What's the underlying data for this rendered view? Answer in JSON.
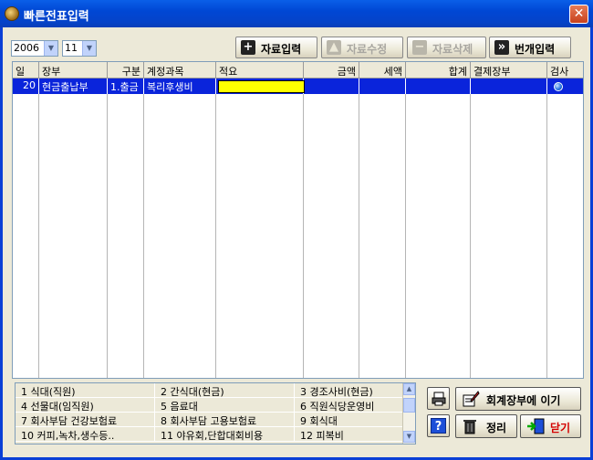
{
  "window": {
    "title": "빠른전표입력",
    "close": "✕"
  },
  "filters": {
    "year": "2006",
    "month": "11"
  },
  "toolbar": {
    "add": {
      "label": "자료입력",
      "icon": "plus-icon"
    },
    "edit": {
      "label": "자료수정",
      "icon": "triangle-up-icon"
    },
    "delete": {
      "label": "자료삭제",
      "icon": "minus-icon"
    },
    "bulk": {
      "label": "번개입력",
      "icon": "double-chevron-down-icon"
    }
  },
  "grid": {
    "columns": [
      "일",
      "장부",
      "구분",
      "계정과목",
      "적요",
      "금액",
      "세액",
      "합계",
      "결제장부",
      "검사"
    ],
    "rows": [
      {
        "day": "20",
        "ledger": "현금출납부",
        "type": "1.출금",
        "account": "복리후생비",
        "memo": "",
        "amount": "",
        "tax": "",
        "total": "",
        "payment_ledger": "",
        "check": "blue-dot"
      }
    ]
  },
  "accounts": [
    [
      "1 식대(직원)",
      "2 간식대(현금)",
      "3 경조사비(현금)"
    ],
    [
      "4 선물대(임직원)",
      "5 음료대",
      "6 직원식당운영비"
    ],
    [
      "7 회사부담 건강보험료",
      "8 회사부담 고용보험료",
      "9 회식대"
    ],
    [
      "10 커피,녹차,생수등..",
      "11 야유회,단합대회비용",
      "12 피복비"
    ]
  ],
  "buttons": {
    "to_ledger": "회계장부에 이기",
    "tidy": "정리",
    "close": "닫기"
  },
  "colors": {
    "selection": "#0A24DB",
    "edit_cell": "#FFFF00",
    "title_bar": "#0047D4"
  }
}
